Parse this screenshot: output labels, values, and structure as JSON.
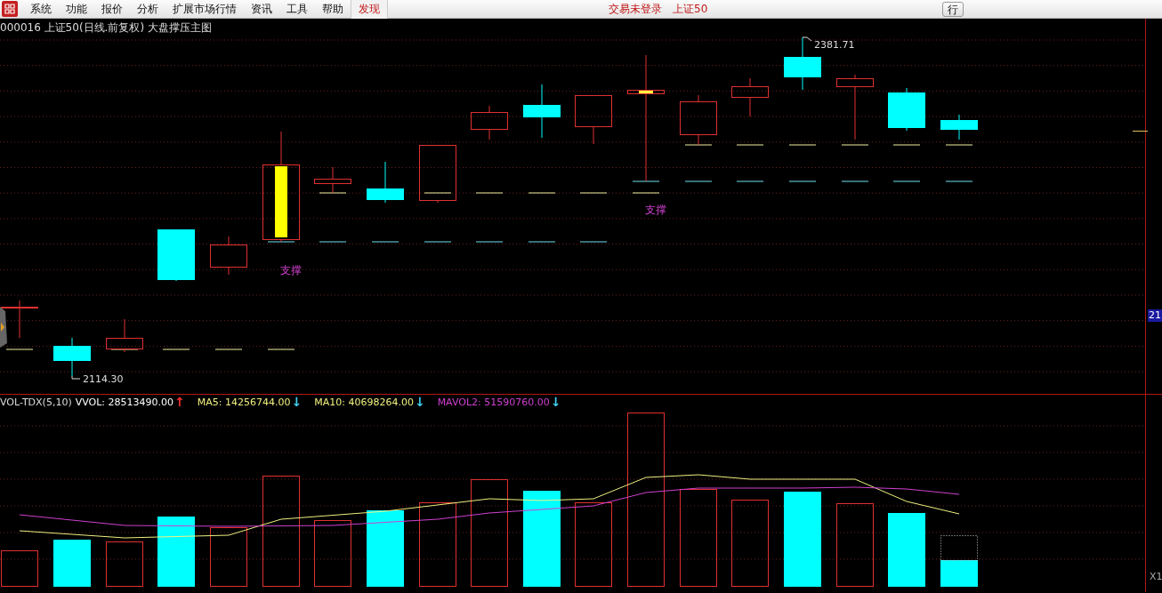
{
  "menu": {
    "items": [
      {
        "label": "系统",
        "highlight": false
      },
      {
        "label": "功能",
        "highlight": false
      },
      {
        "label": "报价",
        "highlight": false
      },
      {
        "label": "分析",
        "highlight": false
      },
      {
        "label": "扩展市场行情",
        "highlight": false
      },
      {
        "label": "资讯",
        "highlight": false
      },
      {
        "label": "工具",
        "highlight": false
      },
      {
        "label": "帮助",
        "highlight": false
      },
      {
        "label": "发现",
        "highlight": true
      }
    ]
  },
  "status": {
    "login": "交易未登录",
    "market": "上证50"
  },
  "toolbar_button": "行",
  "chart_title": "000016 上证50(日线.前复权) 大盘撑压主图",
  "price_pane": {
    "high_label": "2381.71",
    "low_label": "2114.30",
    "support_labels": [
      "支撑",
      "支撑"
    ],
    "axis_tag": "21"
  },
  "volume_pane": {
    "indicator": "VOL-TDX(5,10)",
    "legend": [
      {
        "text": "VVOL: 28513490.00",
        "color": "#ffffff",
        "arrow": {
          "text": "↑",
          "color": "#ff3030"
        }
      },
      {
        "text": "MA5: 14256744.00",
        "color": "#f0f080",
        "arrow": {
          "text": "↓",
          "color": "#40d0f0"
        }
      },
      {
        "text": "MA10: 40698264.00",
        "color": "#f0f080",
        "arrow": {
          "text": "↓",
          "color": "#40d0f0"
        }
      },
      {
        "text": "MAVOL2: 51590760.00",
        "color": "#d040d0",
        "arrow": {
          "text": "↓",
          "color": "#40d0f0"
        }
      }
    ],
    "scale_tag": "X1"
  }
}
